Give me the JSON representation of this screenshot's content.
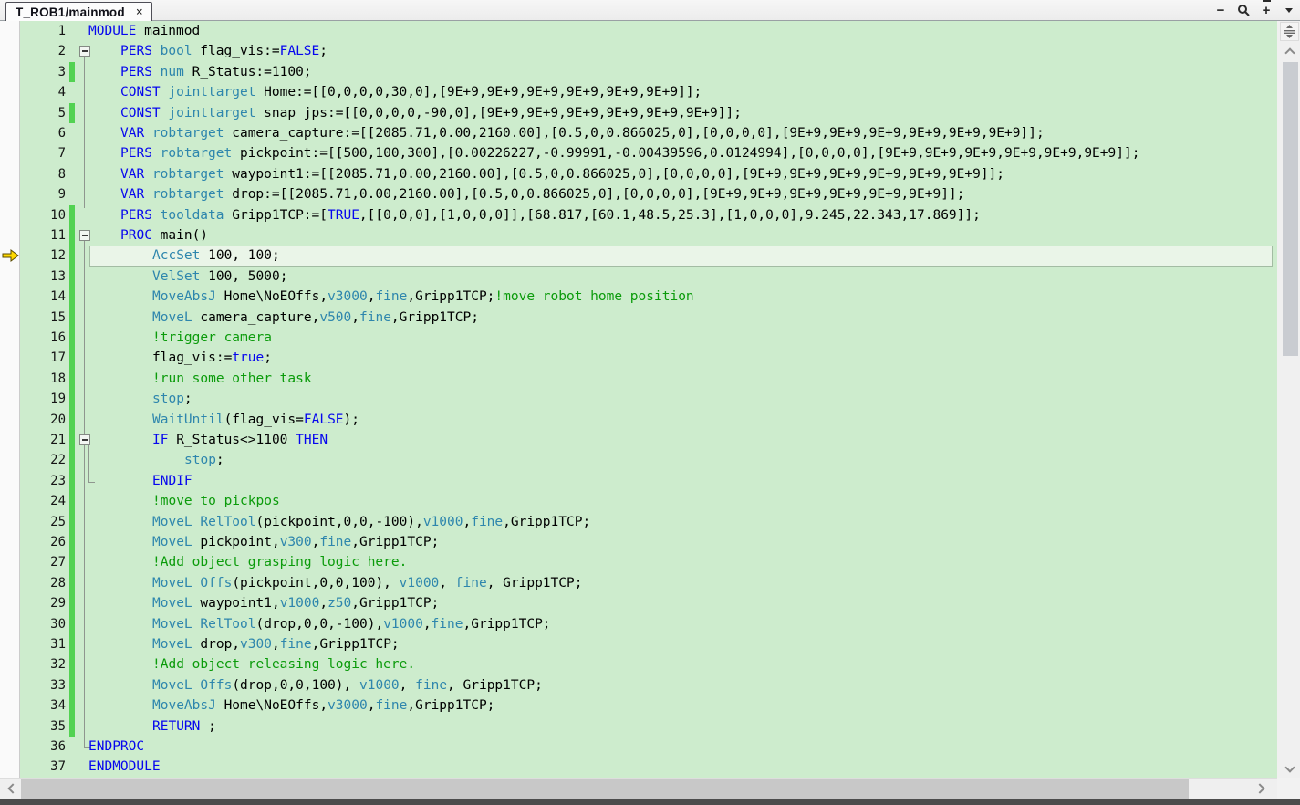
{
  "tab_bar": {
    "tabs": [
      {
        "label": "T_ROB1/mainmod",
        "close_glyph": "×",
        "active": true
      }
    ],
    "controls": {
      "zoom_out_glyph": "−",
      "zoom_in_glyph": "+"
    }
  },
  "colors": {
    "editor_background": "#cdeccd",
    "keyword": "#0606ee",
    "instruction": "#2e86ad",
    "comment": "#0b9b0b",
    "plain_text": "#000000",
    "change_bar": "#52d252",
    "current_line_background": "#eaf5e8",
    "current_line_border": "#a3bca3",
    "exec_arrow": "#ffd800"
  },
  "editor": {
    "language": "RAPID",
    "exec_line": 12,
    "current_line": 12,
    "folds": [
      {
        "start": 2,
        "end": 10,
        "tick": false,
        "nested": false
      },
      {
        "start": 11,
        "end": 36,
        "tick": true,
        "nested": false
      },
      {
        "start": 21,
        "end": 23,
        "tick": true,
        "nested": true
      }
    ],
    "lines": [
      {
        "n": 1,
        "ind": 0,
        "bar": false,
        "fold": false,
        "seg": [
          [
            "k",
            "MODULE"
          ],
          [
            "p",
            " mainmod"
          ]
        ]
      },
      {
        "n": 2,
        "ind": 1,
        "bar": false,
        "fold": true,
        "seg": [
          [
            "k",
            "PERS"
          ],
          [
            "p",
            " "
          ],
          [
            "t",
            "bool"
          ],
          [
            "p",
            " flag_vis:="
          ],
          [
            "k",
            "FALSE"
          ],
          [
            "p",
            ";"
          ]
        ]
      },
      {
        "n": 3,
        "ind": 1,
        "bar": true,
        "fold": false,
        "seg": [
          [
            "k",
            "PERS"
          ],
          [
            "p",
            " "
          ],
          [
            "t",
            "num"
          ],
          [
            "p",
            " R_Status:=1100;"
          ]
        ]
      },
      {
        "n": 4,
        "ind": 1,
        "bar": false,
        "fold": false,
        "seg": [
          [
            "k",
            "CONST"
          ],
          [
            "p",
            " "
          ],
          [
            "t",
            "jointtarget"
          ],
          [
            "p",
            " Home:=[[0,0,0,0,30,0],[9E+9,9E+9,9E+9,9E+9,9E+9,9E+9]];"
          ]
        ]
      },
      {
        "n": 5,
        "ind": 1,
        "bar": true,
        "fold": false,
        "seg": [
          [
            "k",
            "CONST"
          ],
          [
            "p",
            " "
          ],
          [
            "t",
            "jointtarget"
          ],
          [
            "p",
            " snap_jps:=[[0,0,0,0,-90,0],[9E+9,9E+9,9E+9,9E+9,9E+9,9E+9]];"
          ]
        ]
      },
      {
        "n": 6,
        "ind": 1,
        "bar": false,
        "fold": false,
        "seg": [
          [
            "k",
            "VAR"
          ],
          [
            "p",
            " "
          ],
          [
            "t",
            "robtarget"
          ],
          [
            "p",
            " camera_capture:=[[2085.71,0.00,2160.00],[0.5,0,0.866025,0],[0,0,0,0],[9E+9,9E+9,9E+9,9E+9,9E+9,9E+9]];"
          ]
        ]
      },
      {
        "n": 7,
        "ind": 1,
        "bar": false,
        "fold": false,
        "seg": [
          [
            "k",
            "PERS"
          ],
          [
            "p",
            " "
          ],
          [
            "t",
            "robtarget"
          ],
          [
            "p",
            " pickpoint:=[[500,100,300],[0.00226227,-0.99991,-0.00439596,0.0124994],[0,0,0,0],[9E+9,9E+9,9E+9,9E+9,9E+9,9E+9]];"
          ]
        ]
      },
      {
        "n": 8,
        "ind": 1,
        "bar": false,
        "fold": false,
        "seg": [
          [
            "k",
            "VAR"
          ],
          [
            "p",
            " "
          ],
          [
            "t",
            "robtarget"
          ],
          [
            "p",
            " waypoint1:=[[2085.71,0.00,2160.00],[0.5,0,0.866025,0],[0,0,0,0],[9E+9,9E+9,9E+9,9E+9,9E+9,9E+9]];"
          ]
        ]
      },
      {
        "n": 9,
        "ind": 1,
        "bar": false,
        "fold": false,
        "seg": [
          [
            "k",
            "VAR"
          ],
          [
            "p",
            " "
          ],
          [
            "t",
            "robtarget"
          ],
          [
            "p",
            " drop:=[[2085.71,0.00,2160.00],[0.5,0,0.866025,0],[0,0,0,0],[9E+9,9E+9,9E+9,9E+9,9E+9,9E+9]];"
          ]
        ]
      },
      {
        "n": 10,
        "ind": 1,
        "bar": true,
        "fold": false,
        "seg": [
          [
            "k",
            "PERS"
          ],
          [
            "p",
            " "
          ],
          [
            "t",
            "tooldata"
          ],
          [
            "p",
            " Gripp1TCP:=["
          ],
          [
            "k",
            "TRUE"
          ],
          [
            "p",
            ",[[0,0,0],[1,0,0,0]],[68.817,[60.1,48.5,25.3],[1,0,0,0],9.245,22.343,17.869]];"
          ]
        ]
      },
      {
        "n": 11,
        "ind": 1,
        "bar": true,
        "fold": true,
        "seg": [
          [
            "k",
            "PROC"
          ],
          [
            "p",
            " main()"
          ]
        ]
      },
      {
        "n": 12,
        "ind": 2,
        "bar": true,
        "fold": false,
        "seg": [
          [
            "t",
            "AccSet"
          ],
          [
            "p",
            " 100, 100;"
          ]
        ]
      },
      {
        "n": 13,
        "ind": 2,
        "bar": true,
        "fold": false,
        "seg": [
          [
            "t",
            "VelSet"
          ],
          [
            "p",
            " 100, 5000;"
          ]
        ]
      },
      {
        "n": 14,
        "ind": 2,
        "bar": true,
        "fold": false,
        "seg": [
          [
            "t",
            "MoveAbsJ"
          ],
          [
            "p",
            " Home\\NoEOffs,"
          ],
          [
            "t",
            "v3000"
          ],
          [
            "p",
            ","
          ],
          [
            "t",
            "fine"
          ],
          [
            "p",
            ",Gripp1TCP;"
          ],
          [
            "c",
            "!move robot home position"
          ]
        ]
      },
      {
        "n": 15,
        "ind": 2,
        "bar": true,
        "fold": false,
        "seg": [
          [
            "t",
            "MoveL"
          ],
          [
            "p",
            " camera_capture,"
          ],
          [
            "t",
            "v500"
          ],
          [
            "p",
            ","
          ],
          [
            "t",
            "fine"
          ],
          [
            "p",
            ",Gripp1TCP;"
          ]
        ]
      },
      {
        "n": 16,
        "ind": 2,
        "bar": true,
        "fold": false,
        "seg": [
          [
            "c",
            "!trigger camera"
          ]
        ]
      },
      {
        "n": 17,
        "ind": 2,
        "bar": true,
        "fold": false,
        "seg": [
          [
            "p",
            "flag_vis:="
          ],
          [
            "k",
            "true"
          ],
          [
            "p",
            ";"
          ]
        ]
      },
      {
        "n": 18,
        "ind": 2,
        "bar": true,
        "fold": false,
        "seg": [
          [
            "c",
            "!run some other task"
          ]
        ]
      },
      {
        "n": 19,
        "ind": 2,
        "bar": true,
        "fold": false,
        "seg": [
          [
            "t",
            "stop"
          ],
          [
            "p",
            ";"
          ]
        ]
      },
      {
        "n": 20,
        "ind": 2,
        "bar": true,
        "fold": false,
        "seg": [
          [
            "t",
            "WaitUntil"
          ],
          [
            "p",
            "(flag_vis="
          ],
          [
            "k",
            "FALSE"
          ],
          [
            "p",
            ");"
          ]
        ]
      },
      {
        "n": 21,
        "ind": 2,
        "bar": true,
        "fold": true,
        "seg": [
          [
            "k",
            "IF"
          ],
          [
            "p",
            " R_Status<>1100 "
          ],
          [
            "k",
            "THEN"
          ]
        ]
      },
      {
        "n": 22,
        "ind": 3,
        "bar": true,
        "fold": false,
        "seg": [
          [
            "t",
            "stop"
          ],
          [
            "p",
            ";"
          ]
        ]
      },
      {
        "n": 23,
        "ind": 2,
        "bar": true,
        "fold": false,
        "seg": [
          [
            "k",
            "ENDIF"
          ]
        ]
      },
      {
        "n": 24,
        "ind": 2,
        "bar": true,
        "fold": false,
        "seg": [
          [
            "c",
            "!move to pickpos"
          ]
        ]
      },
      {
        "n": 25,
        "ind": 2,
        "bar": true,
        "fold": false,
        "seg": [
          [
            "t",
            "MoveL"
          ],
          [
            "p",
            " "
          ],
          [
            "t",
            "RelTool"
          ],
          [
            "p",
            "(pickpoint,0,0,-100),"
          ],
          [
            "t",
            "v1000"
          ],
          [
            "p",
            ","
          ],
          [
            "t",
            "fine"
          ],
          [
            "p",
            ",Gripp1TCP;"
          ]
        ]
      },
      {
        "n": 26,
        "ind": 2,
        "bar": true,
        "fold": false,
        "seg": [
          [
            "t",
            "MoveL"
          ],
          [
            "p",
            " pickpoint,"
          ],
          [
            "t",
            "v300"
          ],
          [
            "p",
            ","
          ],
          [
            "t",
            "fine"
          ],
          [
            "p",
            ",Gripp1TCP;"
          ]
        ]
      },
      {
        "n": 27,
        "ind": 2,
        "bar": true,
        "fold": false,
        "seg": [
          [
            "c",
            "!Add object grasping logic here."
          ]
        ]
      },
      {
        "n": 28,
        "ind": 2,
        "bar": true,
        "fold": false,
        "seg": [
          [
            "t",
            "MoveL"
          ],
          [
            "p",
            " "
          ],
          [
            "t",
            "Offs"
          ],
          [
            "p",
            "(pickpoint,0,0,100), "
          ],
          [
            "t",
            "v1000"
          ],
          [
            "p",
            ", "
          ],
          [
            "t",
            "fine"
          ],
          [
            "p",
            ", Gripp1TCP;"
          ]
        ]
      },
      {
        "n": 29,
        "ind": 2,
        "bar": true,
        "fold": false,
        "seg": [
          [
            "t",
            "MoveL"
          ],
          [
            "p",
            " waypoint1,"
          ],
          [
            "t",
            "v1000"
          ],
          [
            "p",
            ","
          ],
          [
            "t",
            "z50"
          ],
          [
            "p",
            ",Gripp1TCP;"
          ]
        ]
      },
      {
        "n": 30,
        "ind": 2,
        "bar": true,
        "fold": false,
        "seg": [
          [
            "t",
            "MoveL"
          ],
          [
            "p",
            " "
          ],
          [
            "t",
            "RelTool"
          ],
          [
            "p",
            "(drop,0,0,-100),"
          ],
          [
            "t",
            "v1000"
          ],
          [
            "p",
            ","
          ],
          [
            "t",
            "fine"
          ],
          [
            "p",
            ",Gripp1TCP;"
          ]
        ]
      },
      {
        "n": 31,
        "ind": 2,
        "bar": true,
        "fold": false,
        "seg": [
          [
            "t",
            "MoveL"
          ],
          [
            "p",
            " drop,"
          ],
          [
            "t",
            "v300"
          ],
          [
            "p",
            ","
          ],
          [
            "t",
            "fine"
          ],
          [
            "p",
            ",Gripp1TCP;"
          ]
        ]
      },
      {
        "n": 32,
        "ind": 2,
        "bar": true,
        "fold": false,
        "seg": [
          [
            "c",
            "!Add object releasing logic here."
          ]
        ]
      },
      {
        "n": 33,
        "ind": 2,
        "bar": true,
        "fold": false,
        "seg": [
          [
            "t",
            "MoveL"
          ],
          [
            "p",
            " "
          ],
          [
            "t",
            "Offs"
          ],
          [
            "p",
            "(drop,0,0,100), "
          ],
          [
            "t",
            "v1000"
          ],
          [
            "p",
            ", "
          ],
          [
            "t",
            "fine"
          ],
          [
            "p",
            ", Gripp1TCP;"
          ]
        ]
      },
      {
        "n": 34,
        "ind": 2,
        "bar": true,
        "fold": false,
        "seg": [
          [
            "t",
            "MoveAbsJ"
          ],
          [
            "p",
            " Home\\NoEOffs,"
          ],
          [
            "t",
            "v3000"
          ],
          [
            "p",
            ","
          ],
          [
            "t",
            "fine"
          ],
          [
            "p",
            ",Gripp1TCP;"
          ]
        ]
      },
      {
        "n": 35,
        "ind": 2,
        "bar": true,
        "fold": false,
        "seg": [
          [
            "k",
            "RETURN"
          ],
          [
            "p",
            " ;"
          ]
        ]
      },
      {
        "n": 36,
        "ind": 0,
        "bar": false,
        "fold": false,
        "seg": [
          [
            "k",
            "ENDPROC"
          ]
        ]
      },
      {
        "n": 37,
        "ind": 0,
        "bar": false,
        "fold": false,
        "seg": [
          [
            "k",
            "ENDMODULE"
          ]
        ]
      }
    ]
  }
}
